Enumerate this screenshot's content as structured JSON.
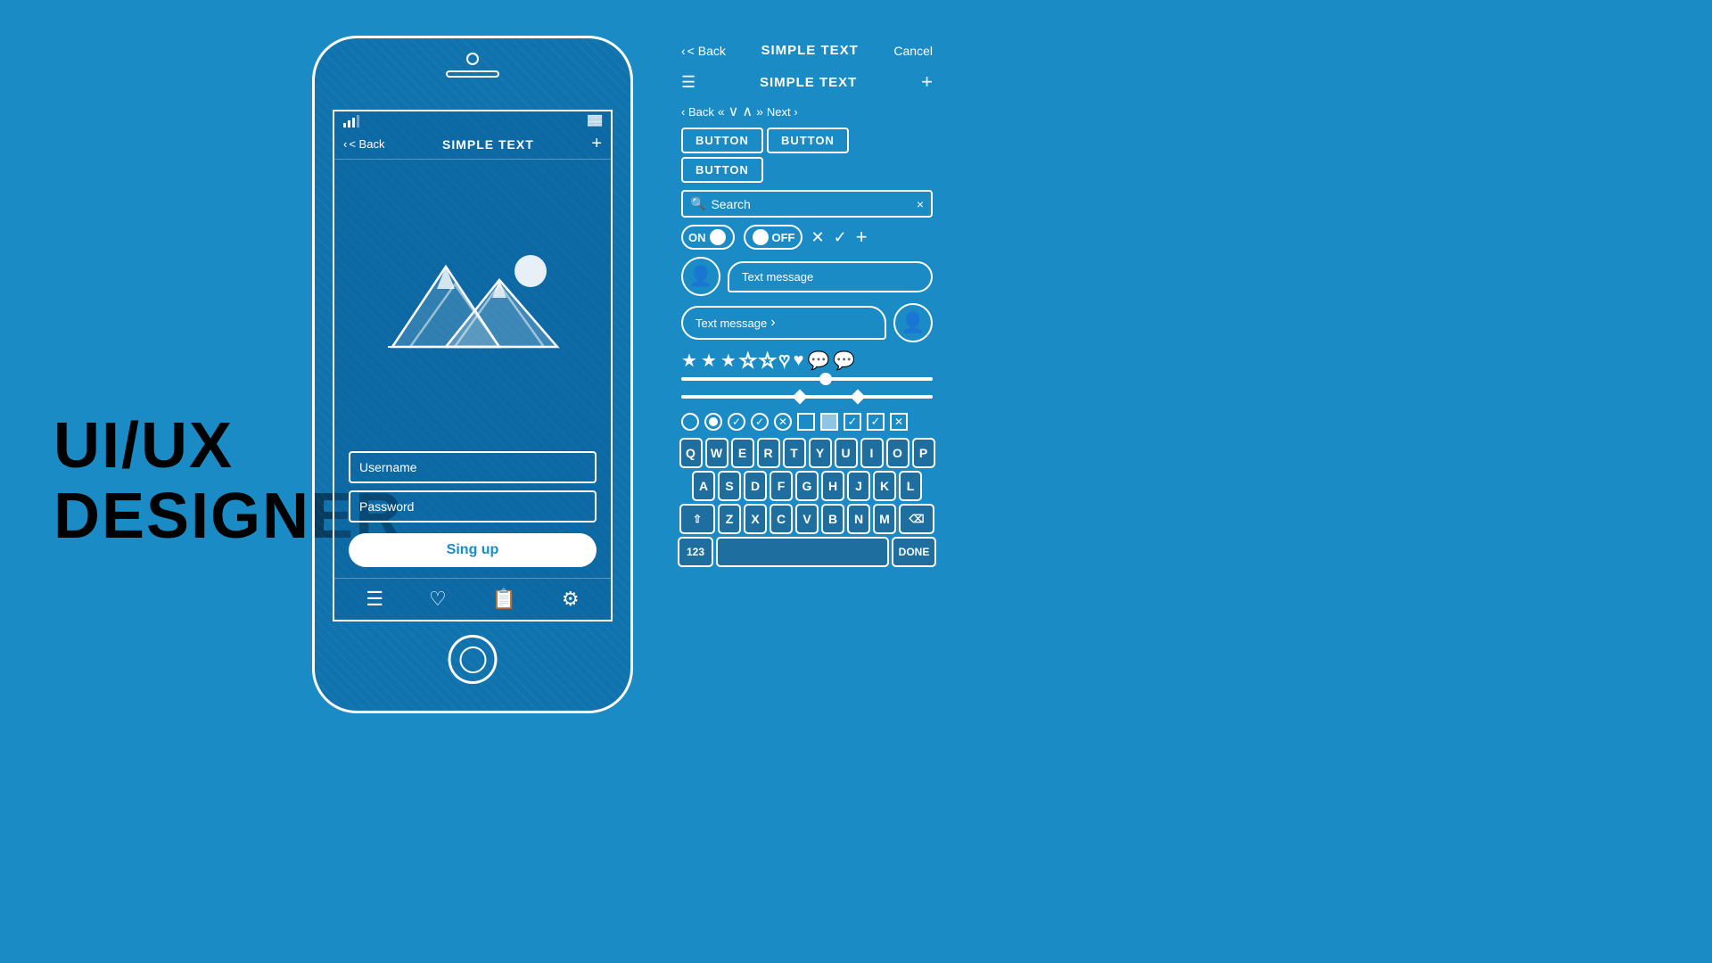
{
  "background": {
    "color": "#1a8bc4"
  },
  "left": {
    "title_line1": "UI/UX",
    "title_line2": "DESIGNER"
  },
  "phone": {
    "nav": {
      "back": "< Back",
      "title": "SIMPLE TEXT",
      "plus": "+"
    },
    "form": {
      "username_placeholder": "Username",
      "password_placeholder": "Password",
      "signup_label": "Sing up"
    },
    "bottom_icons": [
      "☰",
      "♡",
      "📋",
      "⚙"
    ]
  },
  "ui_kit": {
    "nav_bar_1": {
      "back": "< Back",
      "title": "SIMPLE TEXT",
      "cancel": "Cancel"
    },
    "nav_bar_2": {
      "title": "SIMPLE TEXT",
      "plus": "+"
    },
    "nav_bar_3": {
      "back": "< Back",
      "prev_prev": "«",
      "down": "∨",
      "up": "∧",
      "next_next": "»",
      "next": "Next >"
    },
    "buttons": [
      "BUTTON",
      "BUTTON",
      "BUTTON"
    ],
    "search": {
      "placeholder": "Search",
      "clear": "×"
    },
    "toggles": {
      "on_label": "ON",
      "off_label": "OFF"
    },
    "messages": {
      "text1": "Text message",
      "text2": "Text message"
    },
    "keyboard": {
      "row1": [
        "Q",
        "W",
        "E",
        "R",
        "T",
        "Y",
        "U",
        "I",
        "O",
        "P"
      ],
      "row2": [
        "A",
        "S",
        "D",
        "F",
        "G",
        "H",
        "J",
        "K",
        "L"
      ],
      "row3": [
        "⇧",
        "Z",
        "X",
        "C",
        "V",
        "B",
        "N",
        "M",
        "⌫"
      ],
      "row4_left": "123",
      "row4_done": "DONE"
    }
  }
}
